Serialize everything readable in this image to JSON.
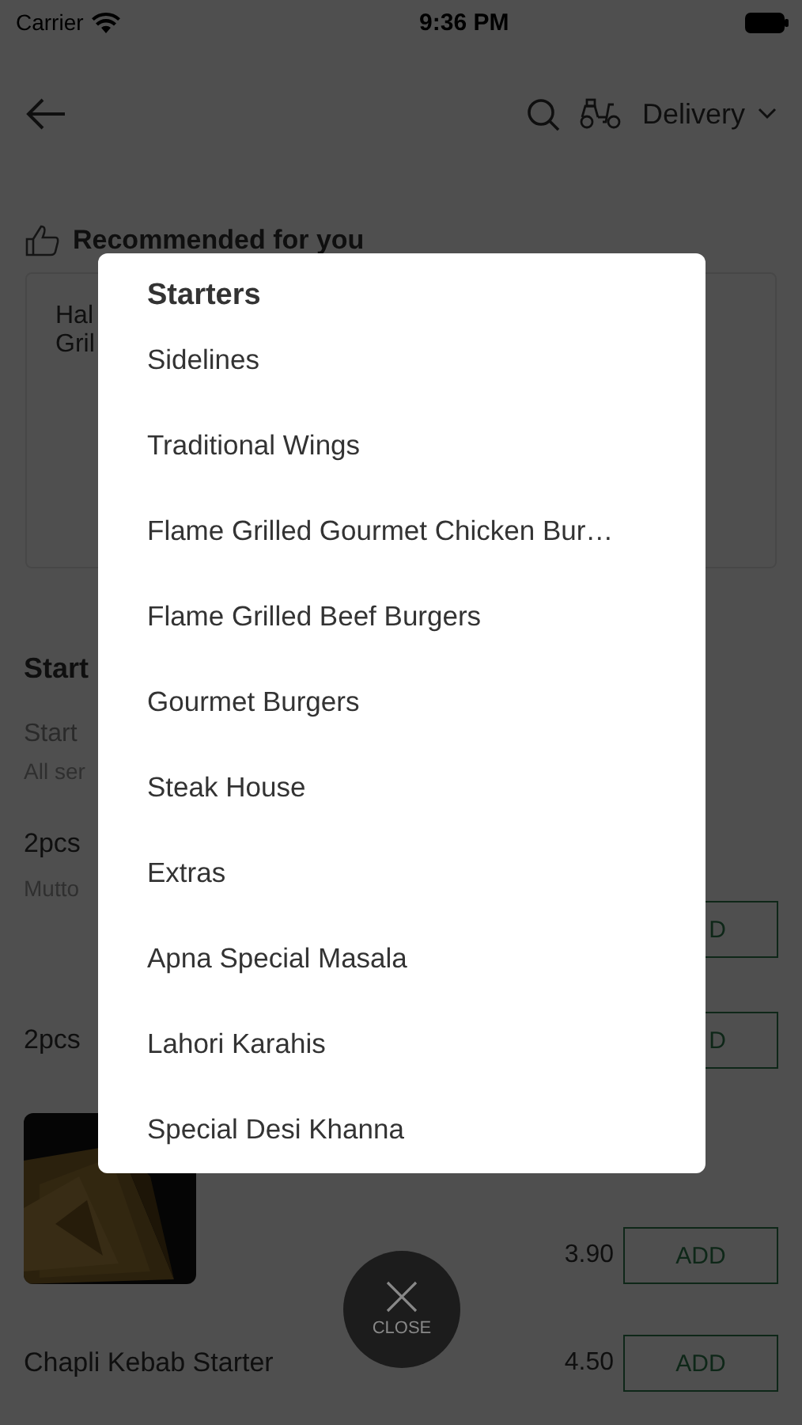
{
  "status_bar": {
    "carrier": "Carrier",
    "time": "9:36 PM"
  },
  "header": {
    "delivery_mode": "Delivery"
  },
  "recommended": {
    "title": "Recommended for you",
    "card_lines": [
      "Hal",
      "Gril"
    ]
  },
  "section": {
    "title": "Start",
    "subtitle": "Start",
    "note": "All ser"
  },
  "items": [
    {
      "name": "2pcs",
      "description": "Mutto",
      "button": "D"
    },
    {
      "name": "2pcs",
      "button": "D"
    },
    {
      "kind": "picture",
      "price": "3.90",
      "button": "ADD"
    },
    {
      "name": "Chapli Kebab Starter",
      "price": "4.50",
      "button": "ADD"
    }
  ],
  "menu": {
    "title": "Starters",
    "items": [
      "Sidelines",
      "Traditional Wings",
      "Flame Grilled Gourmet Chicken Bur…",
      "Flame Grilled Beef Burgers",
      "Gourmet Burgers",
      "Steak House",
      "Extras",
      "Apna Special Masala",
      "Lahori Karahis",
      "Special Desi Khanna"
    ]
  },
  "close_button": {
    "label": "CLOSE"
  }
}
